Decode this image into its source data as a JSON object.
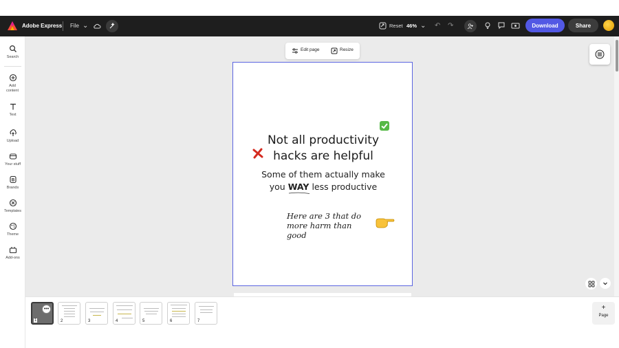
{
  "app": {
    "name": "Adobe Express",
    "file_menu": "File"
  },
  "toolbar": {
    "reset_label": "Reset",
    "zoom_level": "46%",
    "download_label": "Download",
    "share_label": "Share"
  },
  "rail": {
    "items": [
      {
        "label": "Search",
        "icon": "search-icon"
      },
      {
        "label": "Add content",
        "icon": "plus-circle-icon"
      },
      {
        "label": "Text",
        "icon": "text-icon"
      },
      {
        "label": "Upload",
        "icon": "upload-icon"
      },
      {
        "label": "Your stuff",
        "icon": "folder-icon"
      },
      {
        "label": "Brands",
        "icon": "brand-icon"
      },
      {
        "label": "Templates",
        "icon": "templates-icon"
      },
      {
        "label": "Theme",
        "icon": "theme-icon"
      },
      {
        "label": "Add-ons",
        "icon": "addons-icon"
      }
    ]
  },
  "page_toolbar": {
    "edit_label": "Edit page",
    "resize_label": "Resize"
  },
  "artboard": {
    "title_line1": "Not all productivity",
    "title_line2": "hacks are helpful",
    "sub_line1": "Some of them actually make",
    "sub_you": "you",
    "sub_way": "WAY",
    "sub_rest": "less productive",
    "hand_line1": "Here are 3 that do",
    "hand_line2": "more harm than",
    "hand_line3": "good"
  },
  "pages": {
    "numbers": [
      "1",
      "2",
      "3",
      "4",
      "5",
      "6",
      "7"
    ],
    "add_label": "Page"
  },
  "colors": {
    "accent": "#5258e4",
    "topbar": "#1e1e1e",
    "canvas": "#ebebeb",
    "selection": "#5a63e0"
  }
}
